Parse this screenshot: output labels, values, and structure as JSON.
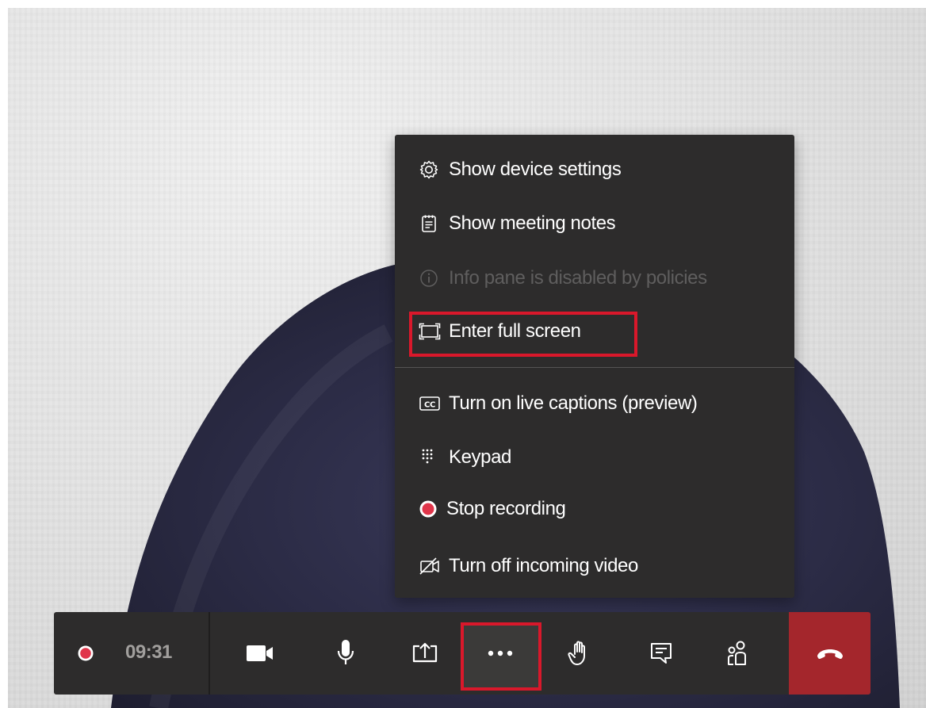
{
  "video": {
    "description_icon": "participant-video-feed"
  },
  "menu": {
    "items": [
      {
        "label": "Show device settings",
        "icon": "gear-icon",
        "enabled": true
      },
      {
        "label": "Show meeting notes",
        "icon": "notes-icon",
        "enabled": true
      },
      {
        "label": "Info pane is disabled by policies",
        "icon": "info-icon",
        "enabled": false
      },
      {
        "label": "Enter full screen",
        "icon": "fullscreen-icon",
        "enabled": true,
        "highlighted": true
      },
      {
        "label": "Turn on live captions (preview)",
        "icon": "captions-icon",
        "enabled": true
      },
      {
        "label": "Keypad",
        "icon": "keypad-icon",
        "enabled": true
      },
      {
        "label": "Stop recording",
        "icon": "record-icon",
        "enabled": true
      },
      {
        "label": "Turn off incoming video",
        "icon": "video-off-icon",
        "enabled": true
      }
    ]
  },
  "callbar": {
    "recording_indicator": "recording-dot-icon",
    "elapsed_time": "09:31",
    "buttons": [
      {
        "name": "camera",
        "icon": "camera-icon"
      },
      {
        "name": "microphone",
        "icon": "microphone-icon"
      },
      {
        "name": "share",
        "icon": "share-screen-icon"
      },
      {
        "name": "more-actions",
        "icon": "more-options-icon",
        "active": true,
        "highlighted": true
      },
      {
        "name": "raise-hand",
        "icon": "raise-hand-icon"
      },
      {
        "name": "chat",
        "icon": "chat-icon"
      },
      {
        "name": "participants",
        "icon": "participants-icon"
      },
      {
        "name": "hang-up",
        "icon": "hang-up-icon"
      }
    ]
  },
  "colors": {
    "menu_bg": "#2d2c2c",
    "highlight_border": "#d9182b",
    "hangup_bg": "#a4262c",
    "record_red": "#e0354a",
    "disabled_text": "#5f5e5e"
  }
}
